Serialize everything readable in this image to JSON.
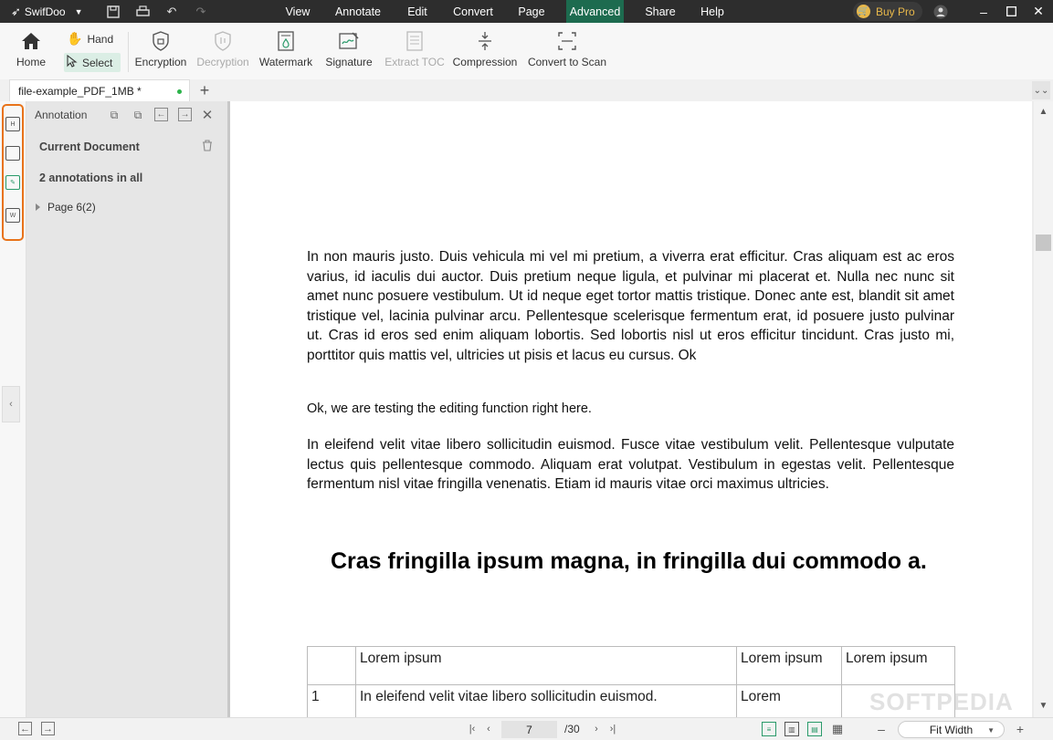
{
  "app": {
    "name": "SwifDoo"
  },
  "menu": [
    "View",
    "Annotate",
    "Edit",
    "Convert",
    "Page",
    "Advanced",
    "Share",
    "Help"
  ],
  "buy_pro": "Buy Pro",
  "ribbon": {
    "home": "Home",
    "hand": "Hand",
    "select": "Select",
    "encryption": "Encryption",
    "decryption": "Decryption",
    "watermark": "Watermark",
    "signature": "Signature",
    "extract_toc": "Extract TOC",
    "compression": "Compression",
    "convert_to_scan": "Convert to Scan"
  },
  "tab": {
    "title": "file-example_PDF_1MB *"
  },
  "panel": {
    "title": "Annotation",
    "current_document": "Current Document",
    "count": "2 annotations in all",
    "page_node": "Page 6(2)"
  },
  "document": {
    "p1": "In non mauris justo. Duis vehicula mi vel mi pretium, a viverra erat efficitur. Cras aliquam est ac eros varius, id iaculis dui auctor. Duis pretium neque ligula, et pulvinar mi placerat et. Nulla nec nunc sit amet nunc posuere vestibulum. Ut id neque eget tortor mattis tristique. Donec ante est, blandit sit amet tristique vel, lacinia pulvinar arcu. Pellentesque scelerisque fermentum erat, id posuere justo pulvinar ut. Cras id eros sed enim aliquam lobortis. Sed lobortis nisl ut eros efficitur tincidunt. Cras justo mi, porttitor quis mattis vel, ultricies ut pisis et lacus eu cursus. Ok",
    "p2": "Ok, we are testing the editing function right here.",
    "p3": "In eleifend velit vitae libero sollicitudin euismod. Fusce vitae vestibulum velit. Pellentesque vulputate lectus quis pellentesque commodo. Aliquam erat volutpat. Vestibulum in egestas velit. Pellentesque fermentum nisl vitae fringilla venenatis. Etiam id mauris vitae orci maximus ultricies.",
    "heading": "Cras fringilla ipsum magna, in fringilla dui commodo a.",
    "table": {
      "header": [
        "",
        "Lorem ipsum",
        "Lorem ipsum",
        "Lorem ipsum"
      ],
      "row1": [
        "1",
        "In eleifend velit vitae libero sollicitudin euismod.",
        "Lorem",
        ""
      ]
    }
  },
  "status": {
    "current_page": "7",
    "total_pages": "/30",
    "zoom": "Fit Width"
  },
  "watermark_text": "SOFTPEDIA"
}
